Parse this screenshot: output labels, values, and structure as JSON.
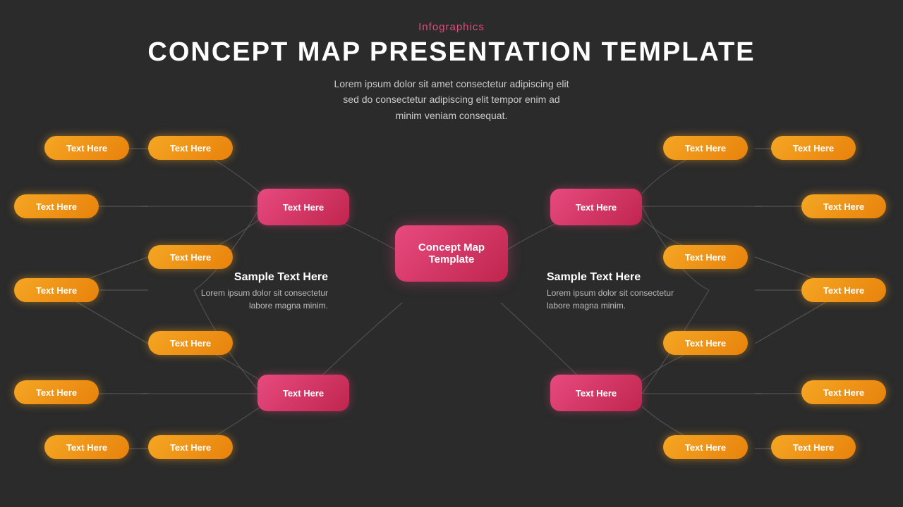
{
  "header": {
    "category": "Infographics",
    "title": "CONCEPT MAP PRESENTATION TEMPLATE",
    "subtitle": "Lorem ipsum dolor sit amet consectetur adipiscing elit\nsed do consectetur adipiscing elit tempor enim ad\nminim veniam consequat."
  },
  "center_node": {
    "line1": "Concept Map",
    "line2": "Template"
  },
  "left_sample": {
    "heading": "Sample Text Here",
    "body": "Lorem ipsum dolor sit consectetur\nlabore magna minim."
  },
  "right_sample": {
    "heading": "Sample Text Here",
    "body": "Lorem ipsum dolor sit consectetur\nlabore magna minim."
  },
  "nodes": {
    "top_left_red": "Text Here",
    "top_right_red": "Text Here",
    "bottom_left_red": "Text Here",
    "bottom_right_red": "Text Here",
    "left_top_orange": "Text Here",
    "left_mid_top_orange": "Text Here",
    "left_mid_bot_orange": "Text Here",
    "left_bot_orange": "Text Here",
    "right_top_orange": "Text Here",
    "right_mid_top_orange": "Text Here",
    "right_mid_bot_orange": "Text Here",
    "right_bot_orange": "Text Here",
    "far_left_top_orange": "Text Here",
    "far_left_mid_top_orange": "Text Here",
    "far_left_mid_bot_orange": "Text Here",
    "far_left_bot_orange": "Text Here",
    "far_right_top_orange": "Text Here",
    "far_right_mid_top_orange": "Text Here",
    "far_right_mid_bot_orange": "Text Here",
    "far_right_bot_orange": "Text Here"
  }
}
